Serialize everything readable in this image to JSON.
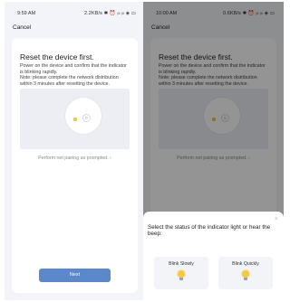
{
  "left_screen": {
    "status_time": "9:59 AM",
    "status_network": "2.2KB/s ✱ ⏰ ᵢₗₗ ᵢₗₗ ◈ ▭",
    "cancel_label": "Cancel",
    "title": "Reset the device first.",
    "desc_lines": [
      "Power on the device and confirm that the indicator",
      "is blinking rapidly.",
      "Note: please complete the network distribution",
      "within 3 minutes after resetting the device."
    ],
    "pairing_link": "Perform net pairing as prompted. ›",
    "next_label": "Next"
  },
  "right_screen": {
    "status_time": "10:00 AM",
    "status_network": "0.6KB/s ✱ ⏰ ᵢₗₗ ᵢₗₗ ◈ ▭",
    "cancel_label": "Cancel",
    "title": "Reset the device first.",
    "desc_lines": [
      "Power on the device and confirm that the indicator",
      "is blinking rapidly.",
      "Note: please complete the network distribution",
      "within 3 minutes after resetting the device."
    ],
    "pairing_link": "Perform net pairing as prompted. ›",
    "sheet": {
      "close_icon": "×",
      "question": "Select the status of the indicator light or hear the beep:",
      "option_slow": "Blink Slowly",
      "option_quick": "Blink Quickly"
    }
  },
  "colors": {
    "accent": "#5b88c9",
    "background": "#f3f4f9",
    "bulb": "#f5c842"
  },
  "icons": [
    "disc-illustration",
    "close-icon",
    "bulb-icon",
    "chevron-right-icon"
  ]
}
